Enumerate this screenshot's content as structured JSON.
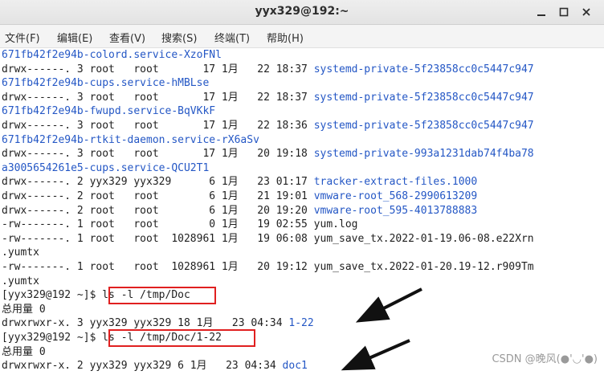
{
  "window": {
    "title": "yyx329@192:~"
  },
  "menu": [
    {
      "label": "文件(F)"
    },
    {
      "label": "编辑(E)"
    },
    {
      "label": "查看(V)"
    },
    {
      "label": "搜索(S)"
    },
    {
      "label": "终端(T)"
    },
    {
      "label": "帮助(H)"
    }
  ],
  "terminal": {
    "lines": [
      {
        "a": "",
        "b": "671fb42f2e94b-colord.service-XzoFNl"
      },
      {
        "a": "drwx------. 3 root   root       17 1月   22 18:37 ",
        "b": "systemd-private-5f23858cc0c5447c947"
      },
      {
        "a": "",
        "b": "671fb42f2e94b-cups.service-hMBLse"
      },
      {
        "a": "drwx------. 3 root   root       17 1月   22 18:37 ",
        "b": "systemd-private-5f23858cc0c5447c947"
      },
      {
        "a": "",
        "b": "671fb42f2e94b-fwupd.service-BqVKkF"
      },
      {
        "a": "drwx------. 3 root   root       17 1月   22 18:36 ",
        "b": "systemd-private-5f23858cc0c5447c947"
      },
      {
        "a": "",
        "b": "671fb42f2e94b-rtkit-daemon.service-rX6aSv"
      },
      {
        "a": "drwx------. 3 root   root       17 1月   20 19:18 ",
        "b": "systemd-private-993a1231dab74f4ba78"
      },
      {
        "a": "",
        "b": "a3005654261e5-cups.service-QCU2T1"
      },
      {
        "a": "drwx------. 2 yyx329 yyx329      6 1月   23 01:17 ",
        "b": "tracker-extract-files.1000"
      },
      {
        "a": "drwx------. 2 root   root        6 1月   21 19:01 ",
        "b": "vmware-root_568-2990613209"
      },
      {
        "a": "drwx------. 2 root   root        6 1月   20 19:20 ",
        "b": "vmware-root_595-4013788883"
      },
      {
        "a": "-rw-------. 1 root   root        0 1月   19 02:55 yum.log",
        "b": ""
      },
      {
        "a": "-rw-------. 1 root   root  1028961 1月   19 06:08 yum_save_tx.2022-01-19.06-08.e22Xrn",
        "b": ""
      },
      {
        "a": ".yumtx",
        "b": ""
      },
      {
        "a": "-rw-------. 1 root   root  1028961 1月   20 19:12 yum_save_tx.2022-01-20.19-12.r909Tm",
        "b": ""
      },
      {
        "a": ".yumtx",
        "b": ""
      },
      {
        "a": "[yyx329@192 ~]$ ls -l /tmp/Doc",
        "b": ""
      },
      {
        "a": "总用量 0",
        "b": ""
      },
      {
        "a": "drwxrwxr-x. 3 yyx329 yyx329 18 1月   23 04:34 ",
        "b": "1-22"
      },
      {
        "a": "[yyx329@192 ~]$ ls -l /tmp/Doc/1-22",
        "b": ""
      },
      {
        "a": "总用量 0",
        "b": ""
      },
      {
        "a": "drwxrwxr-x. 2 yyx329 yyx329 6 1月   23 04:34 ",
        "b": "doc1"
      }
    ]
  },
  "watermark": "CSDN @晚风(●'◡'●)",
  "colors": {
    "link_blue": "#2457c5",
    "highlight_red": "#e02020"
  }
}
